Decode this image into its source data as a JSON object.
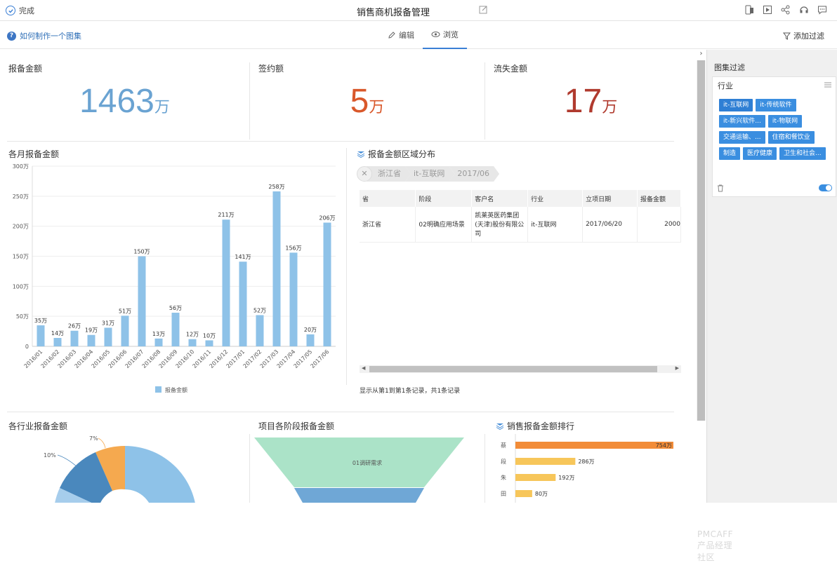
{
  "topbar": {
    "done_label": "完成",
    "title": "销售商机报备管理"
  },
  "subbar": {
    "help_label": "如何制作一个图集",
    "mode_edit": "编辑",
    "mode_browse": "浏览",
    "add_filter": "添加过滤"
  },
  "kpis": [
    {
      "label": "报备金额",
      "value": "1463",
      "unit": "万",
      "color": "#6aa3d2"
    },
    {
      "label": "签约额",
      "value": "5",
      "unit": "万",
      "color": "#d9582b"
    },
    {
      "label": "流失金额",
      "value": "17",
      "unit": "万",
      "color": "#b03a2e"
    }
  ],
  "monthly": {
    "title": "各月报备金额",
    "legend": "报备金额",
    "color": "#8ec2e8"
  },
  "chart_data": {
    "type": "bar",
    "title": "各月报备金额",
    "categories": [
      "2016/01",
      "2016/02",
      "2016/03",
      "2016/04",
      "2016/05",
      "2016/06",
      "2016/07",
      "2016/08",
      "2016/09",
      "2016/10",
      "2016/11",
      "2016/12",
      "2017/01",
      "2017/02",
      "2017/03",
      "2017/04",
      "2017/05",
      "2017/06"
    ],
    "series": [
      {
        "name": "报备金额",
        "values": [
          35,
          14,
          26,
          19,
          31,
          51,
          150,
          13,
          56,
          12,
          10,
          211,
          141,
          52,
          258,
          156,
          20,
          206
        ]
      }
    ],
    "value_labels": [
      "35万",
      "14万",
      "26万",
      "19万",
      "31万",
      "51万",
      "150万",
      "13万",
      "56万",
      "12万",
      "10万",
      "211万",
      "141万",
      "52万",
      "258万",
      "156万",
      "20万",
      "206万"
    ],
    "ylim": [
      0,
      300
    ],
    "yticks": [
      "0",
      "50万",
      "100万",
      "150万",
      "200万",
      "250万",
      "300万"
    ],
    "legend_position": "bottom"
  },
  "region": {
    "title": "报备金额区域分布",
    "crumbs": [
      "浙江省",
      "it-互联网",
      "2017/06"
    ],
    "columns": [
      "省",
      "阶段",
      "客户名",
      "行业",
      "立项日期",
      "报备金额"
    ],
    "rows": [
      [
        "浙江省",
        "02明确应用场景",
        "凯莱英医药集团(天津)股份有限公司",
        "it-互联网",
        "2017/06/20",
        "2000"
      ]
    ],
    "records": "显示从第1到第1条记录，共1条记录"
  },
  "bottom": {
    "industry_title": "各行业报备金额",
    "industry_pcts": [
      "10%",
      "7%"
    ],
    "stage_title": "项目各阶段报备金额",
    "stage_first": "01调研需求",
    "rank_title": "销售报备金额排行",
    "rank": [
      {
        "name": "蔡",
        "value": 754,
        "label": "754万",
        "color": "#f28c38"
      },
      {
        "name": "段",
        "value": 286,
        "label": "286万",
        "color": "#f7c65a"
      },
      {
        "name": "朱",
        "value": 192,
        "label": "192万",
        "color": "#f7c65a"
      },
      {
        "name": "田",
        "value": 80,
        "label": "80万",
        "color": "#f7c65a"
      }
    ]
  },
  "panel": {
    "title": "图集过滤",
    "filter_name": "行业",
    "tags": [
      "it-互联网",
      "it-传统软件",
      "it-新兴软件...",
      "it-物联网",
      "交通运输、...",
      "住宿和餐饮业",
      "制造",
      "医疗健康",
      "卫生和社会..."
    ]
  },
  "watermark": "PMCAFF 产品经理社区"
}
